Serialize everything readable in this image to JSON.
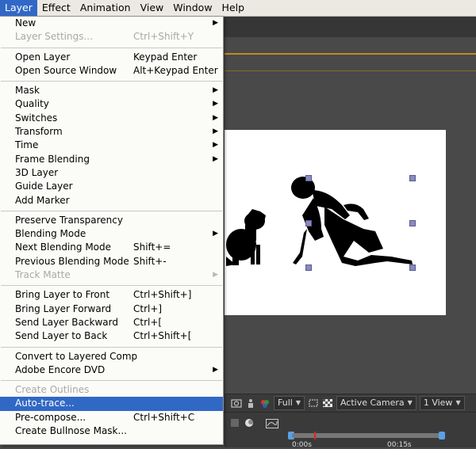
{
  "menubar": [
    {
      "label": "Layer",
      "accel": "L",
      "active": true
    },
    {
      "label": "Effect",
      "accel": "t"
    },
    {
      "label": "Animation",
      "accel": "A"
    },
    {
      "label": "View",
      "accel": "V"
    },
    {
      "label": "Window",
      "accel": ""
    },
    {
      "label": "Help",
      "accel": "H"
    }
  ],
  "menu": {
    "groups": [
      [
        {
          "label": "New",
          "submenu": true
        },
        {
          "label": "Layer Settings...",
          "shortcut": "Ctrl+Shift+Y",
          "disabled": true
        }
      ],
      [
        {
          "label": "Open Layer",
          "shortcut": "Keypad Enter"
        },
        {
          "label": "Open Source Window",
          "shortcut": "Alt+Keypad Enter"
        }
      ],
      [
        {
          "label": "Mask",
          "submenu": true
        },
        {
          "label": "Quality",
          "submenu": true
        },
        {
          "label": "Switches",
          "submenu": true
        },
        {
          "label": "Transform",
          "submenu": true
        },
        {
          "label": "Time",
          "submenu": true
        },
        {
          "label": "Frame Blending",
          "submenu": true
        },
        {
          "label": "3D Layer"
        },
        {
          "label": "Guide Layer"
        },
        {
          "label": "Add Marker"
        }
      ],
      [
        {
          "label": "Preserve Transparency"
        },
        {
          "label": "Blending Mode",
          "submenu": true
        },
        {
          "label": "Next Blending Mode",
          "shortcut": "Shift+="
        },
        {
          "label": "Previous Blending Mode",
          "shortcut": "Shift+-"
        },
        {
          "label": "Track Matte",
          "submenu": true,
          "disabled": true
        }
      ],
      [
        {
          "label": "Bring Layer to Front",
          "shortcut": "Ctrl+Shift+]"
        },
        {
          "label": "Bring Layer Forward",
          "shortcut": "Ctrl+]"
        },
        {
          "label": "Send Layer Backward",
          "shortcut": "Ctrl+["
        },
        {
          "label": "Send Layer to Back",
          "shortcut": "Ctrl+Shift+["
        }
      ],
      [
        {
          "label": "Convert to Layered Comp"
        },
        {
          "label": "Adobe Encore DVD",
          "submenu": true
        }
      ],
      [
        {
          "label": "Create Outlines",
          "disabled": true
        },
        {
          "label": "Auto-trace...",
          "highlight": true
        },
        {
          "label": "Pre-compose...",
          "shortcut": "Ctrl+Shift+C"
        },
        {
          "label": "Create Bullnose Mask..."
        }
      ]
    ]
  },
  "viewer_toolbar": {
    "resolution": "Full",
    "camera": "Active Camera",
    "view": "1 View"
  },
  "timeline": {
    "label_start": "0:00s",
    "label_mid": "00:15s"
  },
  "colors": {
    "highlight": "#3168c6",
    "accent_line": "#c28a1c"
  },
  "icons": {
    "submenu": "chevron-right-icon"
  }
}
